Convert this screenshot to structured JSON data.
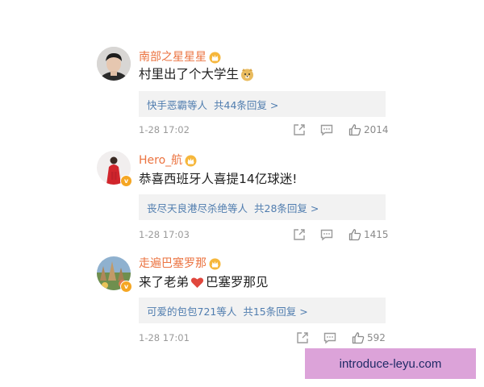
{
  "comments": [
    {
      "username": "南部之星星星",
      "text": "村里出了个大学生",
      "emoji": "doge-emoji",
      "reply_user": "快手恶霸等人",
      "reply_count_text": "共44条回复 >",
      "timestamp": "1-28 17:02",
      "likes": "2014",
      "verified": false
    },
    {
      "username": "Hero_航",
      "text": "恭喜西班牙人喜提14亿球迷!",
      "emoji": null,
      "reply_user": "丧尽天良港尽杀绝等人",
      "reply_count_text": "共28条回复 >",
      "timestamp": "1-28 17:03",
      "likes": "1415",
      "verified": true
    },
    {
      "username": "走遍巴塞罗那",
      "text_before": "来了老弟",
      "text_after": "巴塞罗那见",
      "emoji": "heart-emoji",
      "reply_user": "可爱的包包721等人",
      "reply_count_text": "共15条回复 >",
      "timestamp": "1-28 17:01",
      "likes": "592",
      "verified": true
    }
  ],
  "watermark": "introduce-leyu.com",
  "colors": {
    "username": "#eb7340",
    "reply_link": "#507daf",
    "reply_bg": "#f2f2f2",
    "watermark_bg": "#dca3d9",
    "watermark_text": "#1f2a66"
  }
}
